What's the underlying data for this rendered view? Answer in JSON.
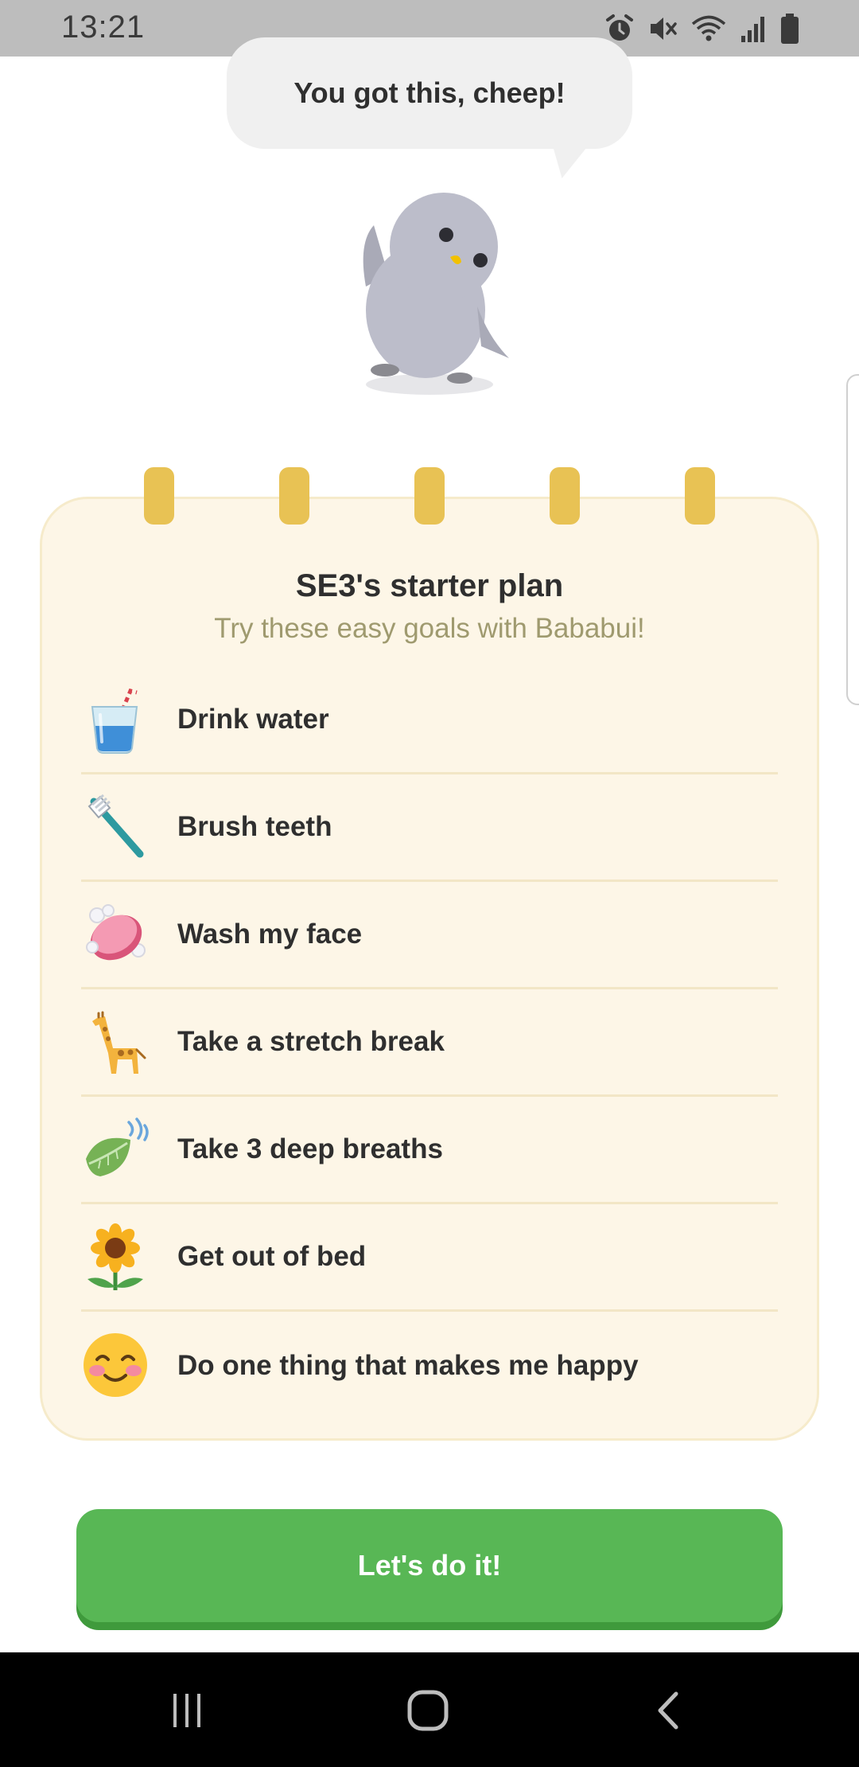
{
  "status_bar": {
    "time": "13:21",
    "icons": [
      "alarm-icon",
      "mute-icon",
      "wifi-icon",
      "signal-icon",
      "battery-icon"
    ]
  },
  "speech_bubble": {
    "text": "You got this, cheep!"
  },
  "plan": {
    "title": "SE3's starter plan",
    "subtitle": "Try these easy goals with Bababui!",
    "goals": [
      {
        "label": "Drink water",
        "icon": "water-glass-icon"
      },
      {
        "label": "Brush teeth",
        "icon": "toothbrush-icon"
      },
      {
        "label": "Wash my face",
        "icon": "soap-icon"
      },
      {
        "label": "Take a stretch break",
        "icon": "giraffe-icon"
      },
      {
        "label": "Take 3 deep breaths",
        "icon": "leaf-wind-icon"
      },
      {
        "label": "Get out of bed",
        "icon": "sunflower-icon"
      },
      {
        "label": "Do one thing that makes me happy",
        "icon": "smiling-face-icon"
      }
    ]
  },
  "cta": {
    "label": "Let's do it!"
  },
  "colors": {
    "card_background": "#fdf6e7",
    "ring": "#e8c254",
    "button": "#58b755",
    "subtitle": "#9f9a6f"
  },
  "nav_bar": {
    "buttons": [
      "recent-apps-icon",
      "home-icon",
      "back-icon"
    ]
  }
}
